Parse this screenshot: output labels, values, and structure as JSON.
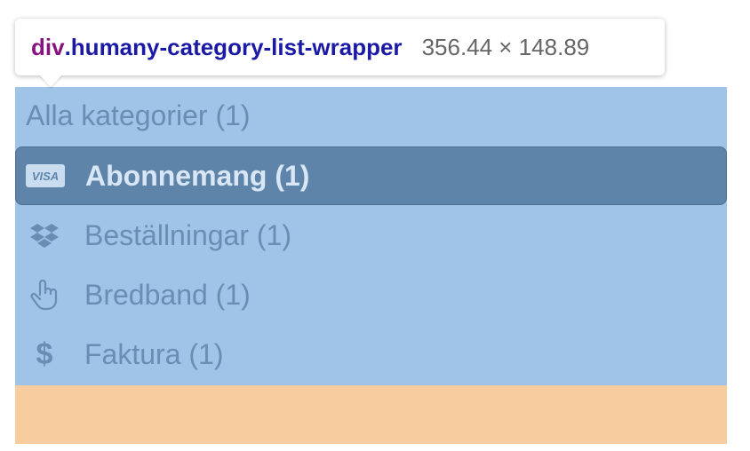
{
  "tooltip": {
    "tag": "div",
    "class_name": ".humany-category-list-wrapper",
    "size": "356.44 × 148.89"
  },
  "category_list": {
    "all_label": "Alla kategorier (1)",
    "items": [
      {
        "label": "Abonnemang (1)",
        "icon": "visa-card-icon",
        "active": true
      },
      {
        "label": "Beställningar (1)",
        "icon": "dropbox-icon",
        "active": false
      },
      {
        "label": "Bredband (1)",
        "icon": "hand-pointer-icon",
        "active": false
      },
      {
        "label": "Faktura (1)",
        "icon": "dollar-icon",
        "active": false
      }
    ]
  },
  "colors": {
    "content_highlight": "#a0c4e8",
    "padding_highlight": "#f7cda0",
    "active_item": "#5e84a9",
    "text": "#6a8db3"
  }
}
